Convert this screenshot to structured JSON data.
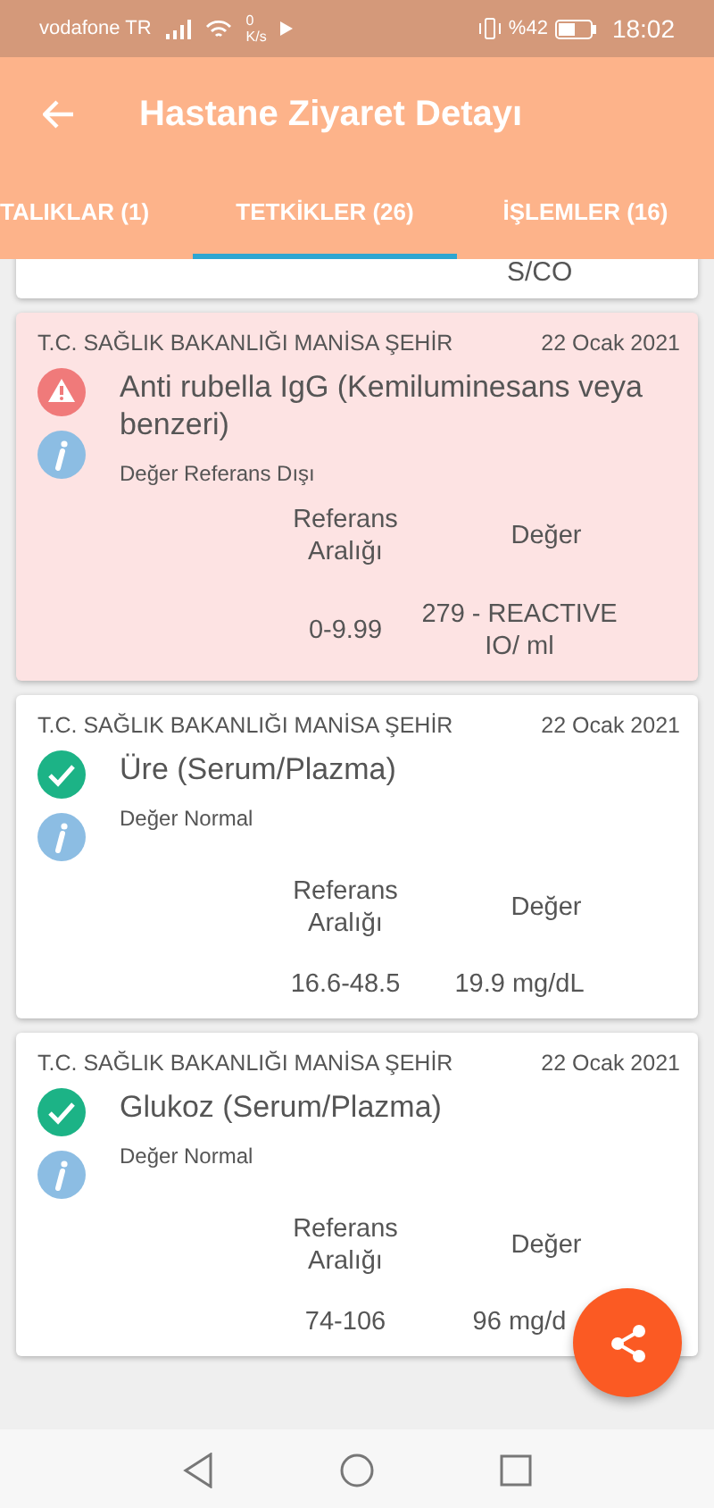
{
  "status_bar": {
    "carrier": "vodafone TR",
    "speed": "0",
    "speed_unit": "K/s",
    "battery": "%42",
    "time": "18:02"
  },
  "app_bar": {
    "title": "Hastane Ziyaret Detayı"
  },
  "tabs": [
    {
      "label": "TALIKLAR (1)",
      "selected": false
    },
    {
      "label": "TETKİKLER (26)",
      "selected": true
    },
    {
      "label": "İŞLEMLER (16)",
      "selected": false
    }
  ],
  "partial_card": {
    "value": "S/CO"
  },
  "results": [
    {
      "kind": "abnormal",
      "hospital": "T.C. SAĞLIK BAKANLIĞI MANİSA ŞEHİR",
      "date": "22 Ocak 2021",
      "test": "Anti rubella IgG (Kemiluminesans veya benzeri)",
      "status": "Değer Referans Dışı",
      "range_label": "Referans Aralığı",
      "value_label": "Değer",
      "range": "0-9.99",
      "value": "279 - REACTIVE IO/ ml"
    },
    {
      "kind": "normal",
      "hospital": "T.C. SAĞLIK BAKANLIĞI MANİSA ŞEHİR",
      "date": "22 Ocak 2021",
      "test": "Üre (Serum/Plazma)",
      "status": "Değer Normal",
      "range_label": "Referans Aralığı",
      "value_label": "Değer",
      "range": "16.6-48.5",
      "value": "19.9 mg/dL"
    },
    {
      "kind": "normal",
      "hospital": "T.C. SAĞLIK BAKANLIĞI MANİSA ŞEHİR",
      "date": "22 Ocak 2021",
      "test": "Glukoz (Serum/Plazma)",
      "status": "Değer Normal",
      "range_label": "Referans Aralığı",
      "value_label": "Değer",
      "range": "74-106",
      "value": "96 mg/d"
    }
  ]
}
